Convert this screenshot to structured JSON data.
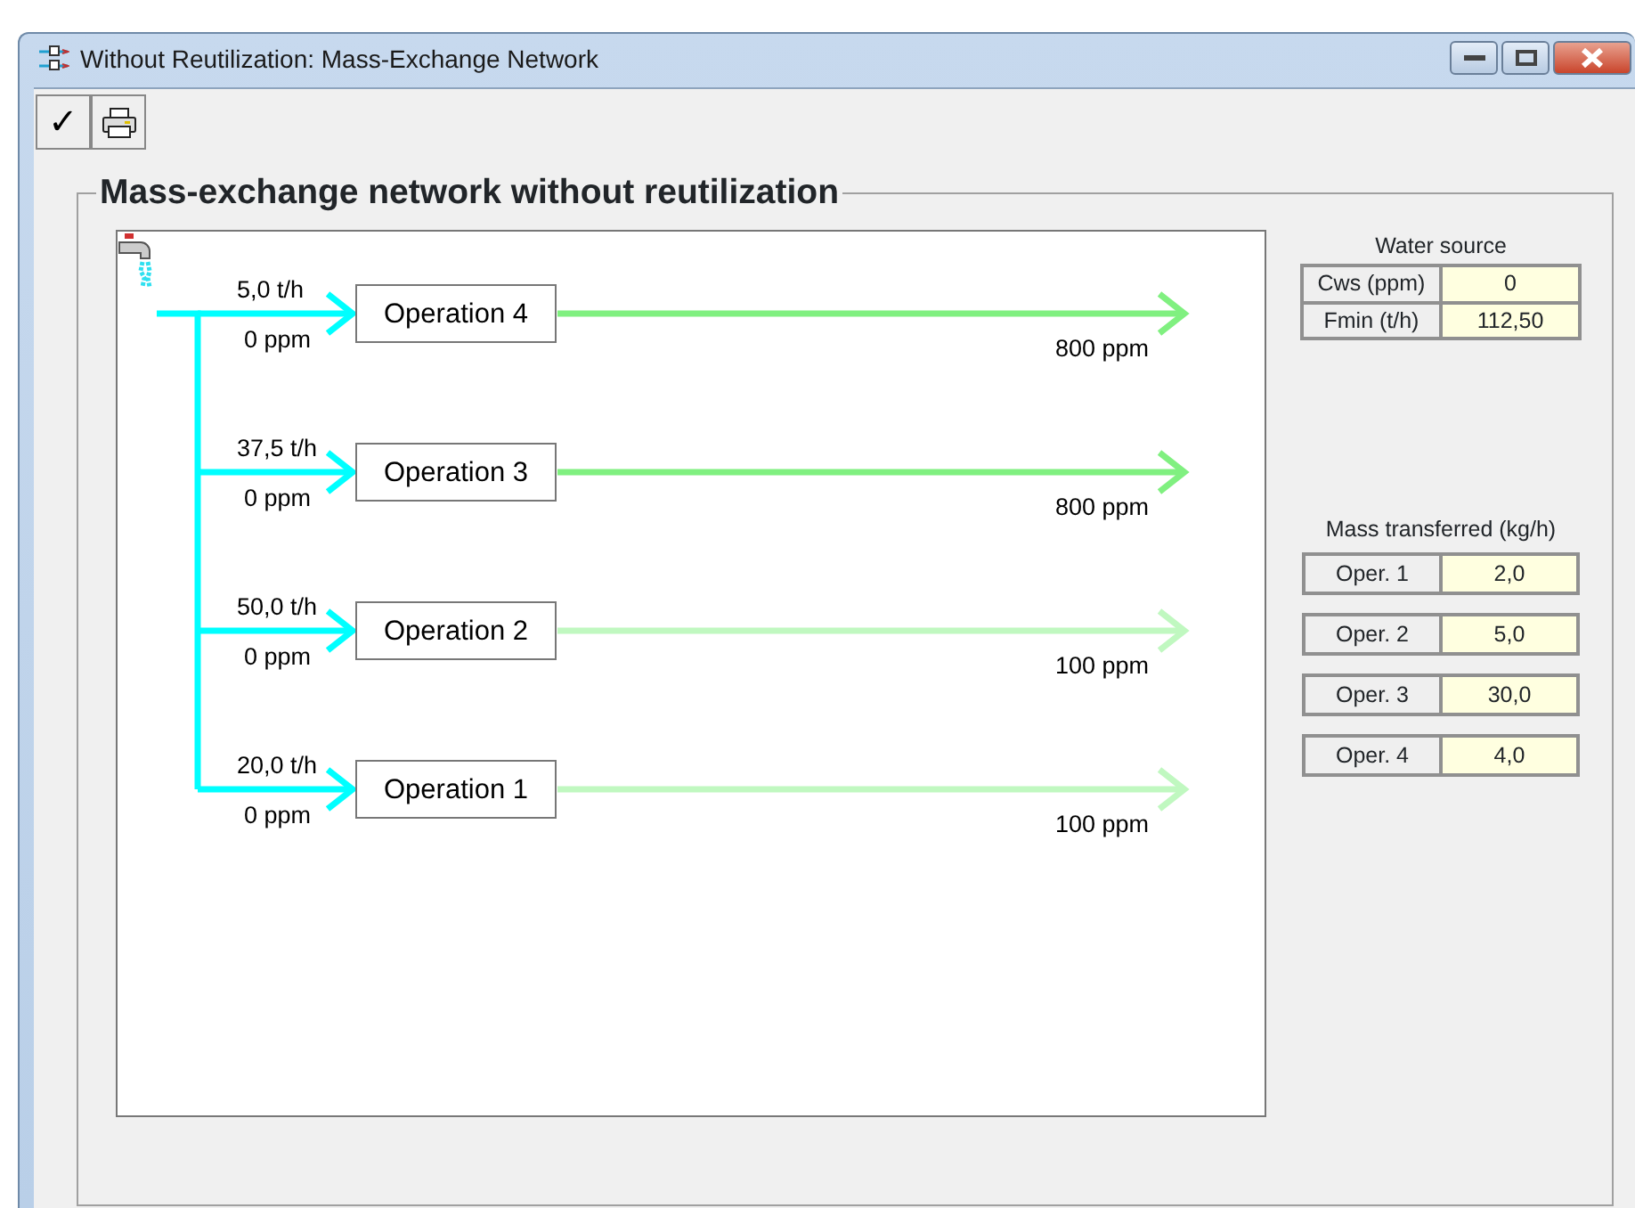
{
  "window": {
    "title": "Without Reutilization: Mass-Exchange Network"
  },
  "toolbar": [
    {
      "kind": "check",
      "label": "✓"
    },
    {
      "kind": "print"
    }
  ],
  "group_title": "Mass-exchange network without reutilization",
  "operations": [
    {
      "name": "Operation 4",
      "flow": "5,0 t/h",
      "inlet": "0 ppm",
      "outlet": "800 ppm",
      "color": "#80f080"
    },
    {
      "name": "Operation 3",
      "flow": "37,5 t/h",
      "inlet": "0 ppm",
      "outlet": "800 ppm",
      "color": "#80f080"
    },
    {
      "name": "Operation 2",
      "flow": "50,0 t/h",
      "inlet": "0 ppm",
      "outlet": "100 ppm",
      "color": "#c0f8c0"
    },
    {
      "name": "Operation 1",
      "flow": "20,0 t/h",
      "inlet": "0 ppm",
      "outlet": "100 ppm",
      "color": "#c0f8c0"
    }
  ],
  "water_source": {
    "title": "Water source",
    "rows": [
      {
        "label": "Cws (ppm)",
        "value": "0"
      },
      {
        "label": "Fmin (t/h)",
        "value": "112,50"
      }
    ]
  },
  "mass_transferred": {
    "title": "Mass transferred (kg/h)",
    "rows": [
      {
        "label": "Oper. 1",
        "value": "2,0"
      },
      {
        "label": "Oper. 2",
        "value": "5,0"
      },
      {
        "label": "Oper. 3",
        "value": "30,0"
      },
      {
        "label": "Oper. 4",
        "value": "4,0"
      }
    ]
  }
}
